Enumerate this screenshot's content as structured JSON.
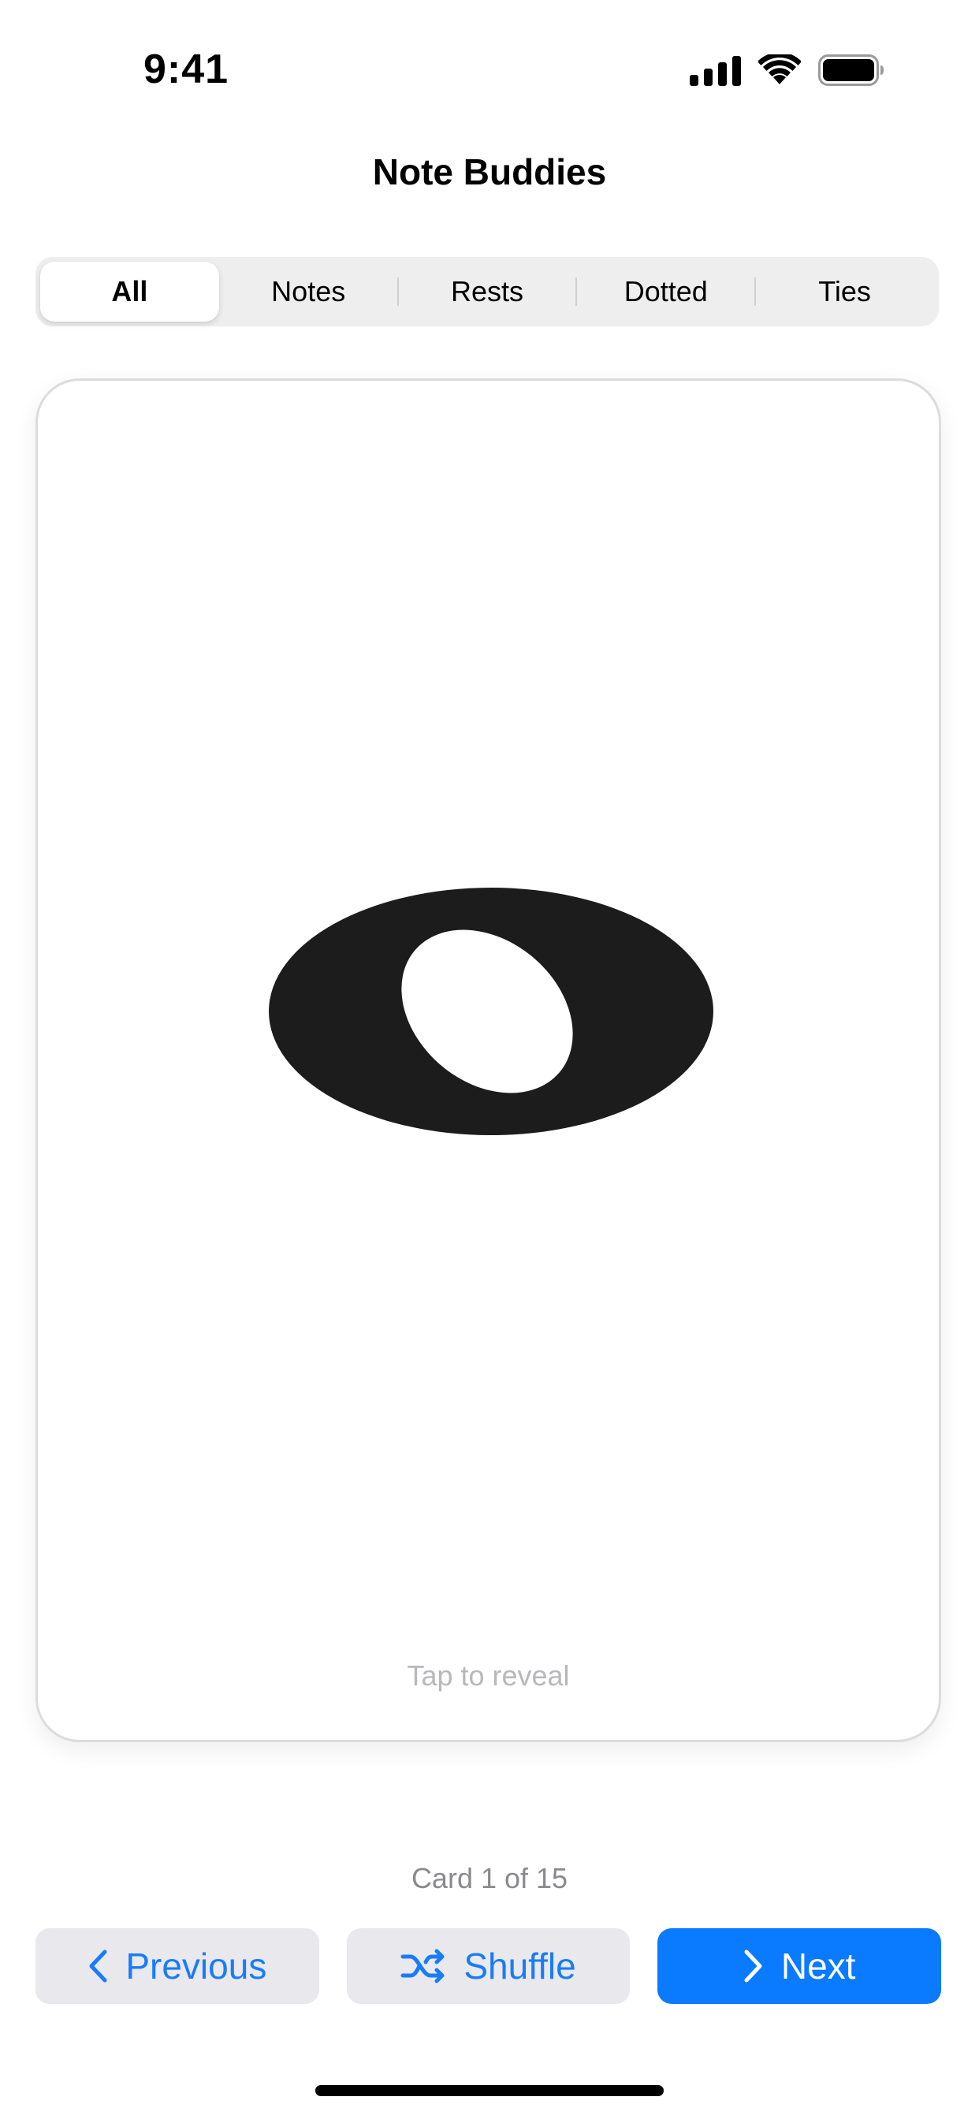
{
  "status_bar": {
    "time": "9:41",
    "icons": [
      "cellular-signal-icon",
      "wifi-icon",
      "battery-icon"
    ]
  },
  "nav": {
    "title": "Note Buddies"
  },
  "filter_tabs": {
    "selected": "All",
    "items": [
      "All",
      "Notes",
      "Rests",
      "Dotted",
      "Ties"
    ]
  },
  "card": {
    "symbol_icon": "whole-note-icon",
    "hint": "Tap to reveal"
  },
  "counter": {
    "text": "Card 1 of 15"
  },
  "controls": {
    "previous_label": "Previous",
    "shuffle_label": "Shuffle",
    "next_label": "Next"
  },
  "colors": {
    "accent": "#0a7aff",
    "secondary_button_bg": "#e8e8ed",
    "segment_bg": "#eeeeef",
    "hint_text": "#b8b8bc",
    "counter_text": "#8a8a8e"
  }
}
